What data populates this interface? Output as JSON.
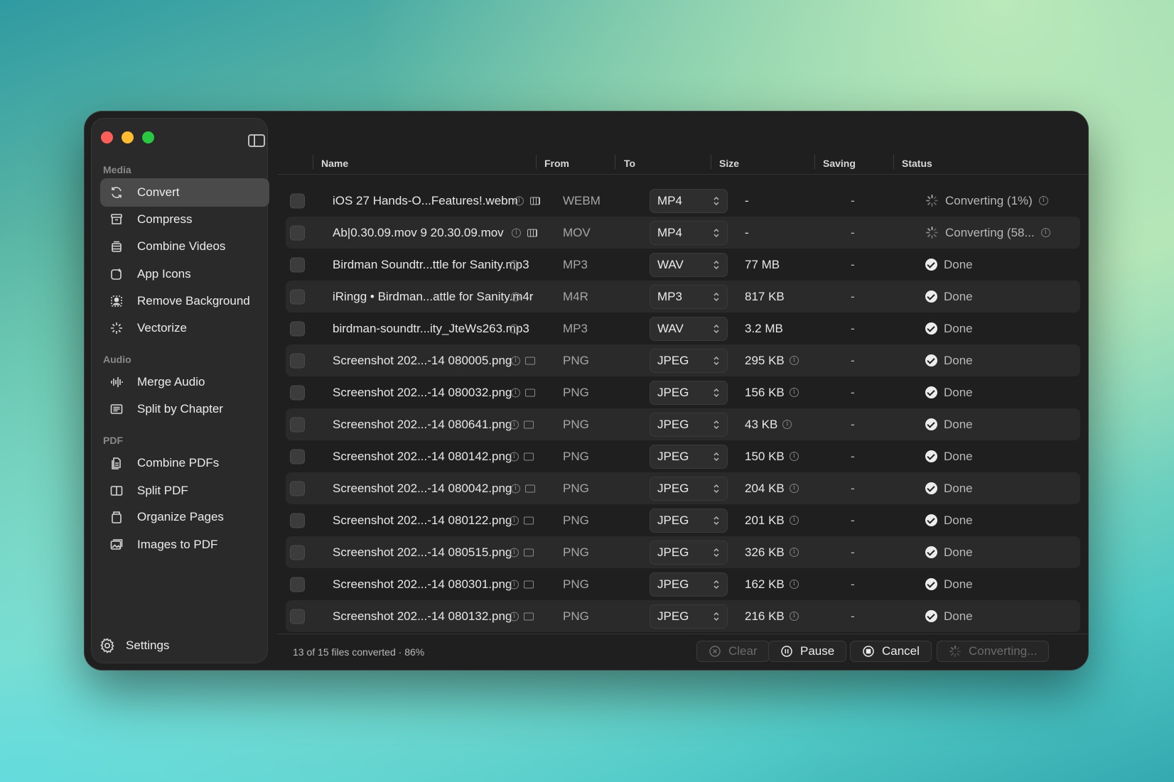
{
  "sidebar": {
    "sections": {
      "media": "Media",
      "audio": "Audio",
      "pdf": "PDF"
    },
    "media_items": [
      {
        "label": "Convert",
        "icon": "refresh-icon",
        "active": true
      },
      {
        "label": "Compress",
        "icon": "archive-icon"
      },
      {
        "label": "Combine Videos",
        "icon": "film-stack-icon"
      },
      {
        "label": "App Icons",
        "icon": "app-icon"
      },
      {
        "label": "Remove Background",
        "icon": "person-cutout-icon"
      },
      {
        "label": "Vectorize",
        "icon": "sparkle-icon"
      }
    ],
    "audio_items": [
      {
        "label": "Merge Audio",
        "icon": "waveform-icon"
      },
      {
        "label": "Split by Chapter",
        "icon": "list-icon"
      }
    ],
    "pdf_items": [
      {
        "label": "Combine PDFs",
        "icon": "documents-icon"
      },
      {
        "label": "Split PDF",
        "icon": "split-pages-icon"
      },
      {
        "label": "Organize Pages",
        "icon": "pages-icon"
      },
      {
        "label": "Images to PDF",
        "icon": "photos-icon"
      }
    ],
    "settings": "Settings"
  },
  "table": {
    "headers": {
      "name": "Name",
      "from": "From",
      "to": "To",
      "size": "Size",
      "saving": "Saving",
      "status": "Status"
    },
    "rows": [
      {
        "name": "iOS 27 Hands-O...Features!.webm",
        "preview": "film",
        "from": "WEBM",
        "to": "MP4",
        "size": "-",
        "size_info": false,
        "saving": "-",
        "status": "Converting (1%)",
        "state": "converting"
      },
      {
        "name": "Ab|0.30.09.mov  9 20.30.09.mov",
        "preview": "film",
        "from": "MOV",
        "to": "MP4",
        "size": "-",
        "size_info": false,
        "saving": "-",
        "status": "Converting (58...",
        "state": "converting"
      },
      {
        "name": "Birdman Soundtr...ttle for Sanity.mp3",
        "preview": "none",
        "from": "MP3",
        "to": "WAV",
        "size": "77 MB",
        "size_info": false,
        "saving": "-",
        "status": "Done",
        "state": "done"
      },
      {
        "name": "iRingg • Birdman...attle for Sanity.m4r",
        "preview": "none",
        "from": "M4R",
        "to": "MP3",
        "size": "817 KB",
        "size_info": false,
        "saving": "-",
        "status": "Done",
        "state": "done"
      },
      {
        "name": "birdman-soundtr...ity_JteWs263.mp3",
        "preview": "none",
        "from": "MP3",
        "to": "WAV",
        "size": "3.2 MB",
        "size_info": false,
        "saving": "-",
        "status": "Done",
        "state": "done"
      },
      {
        "name": "Screenshot 202...-14 080005.png",
        "preview": "image",
        "from": "PNG",
        "to": "JPEG",
        "size": "295 KB",
        "size_info": true,
        "saving": "-",
        "status": "Done",
        "state": "done"
      },
      {
        "name": "Screenshot 202...-14 080032.png",
        "preview": "image",
        "from": "PNG",
        "to": "JPEG",
        "size": "156 KB",
        "size_info": true,
        "saving": "-",
        "status": "Done",
        "state": "done"
      },
      {
        "name": "Screenshot 202...-14 080641.png",
        "preview": "image",
        "from": "PNG",
        "to": "JPEG",
        "size": "43 KB",
        "size_info": true,
        "saving": "-",
        "status": "Done",
        "state": "done"
      },
      {
        "name": "Screenshot 202...-14 080142.png",
        "preview": "image",
        "from": "PNG",
        "to": "JPEG",
        "size": "150 KB",
        "size_info": true,
        "saving": "-",
        "status": "Done",
        "state": "done"
      },
      {
        "name": "Screenshot 202...-14 080042.png",
        "preview": "image",
        "from": "PNG",
        "to": "JPEG",
        "size": "204 KB",
        "size_info": true,
        "saving": "-",
        "status": "Done",
        "state": "done"
      },
      {
        "name": "Screenshot 202...-14 080122.png",
        "preview": "image",
        "from": "PNG",
        "to": "JPEG",
        "size": "201 KB",
        "size_info": true,
        "saving": "-",
        "status": "Done",
        "state": "done"
      },
      {
        "name": "Screenshot 202...-14 080515.png",
        "preview": "image",
        "from": "PNG",
        "to": "JPEG",
        "size": "326 KB",
        "size_info": true,
        "saving": "-",
        "status": "Done",
        "state": "done"
      },
      {
        "name": "Screenshot 202...-14 080301.png",
        "preview": "image",
        "from": "PNG",
        "to": "JPEG",
        "size": "162 KB",
        "size_info": true,
        "saving": "-",
        "status": "Done",
        "state": "done"
      },
      {
        "name": "Screenshot 202...-14 080132.png",
        "preview": "image",
        "from": "PNG",
        "to": "JPEG",
        "size": "216 KB",
        "size_info": true,
        "saving": "-",
        "status": "Done",
        "state": "done"
      }
    ]
  },
  "footer": {
    "progress_text": "13 of 15 files converted · 86%",
    "clear_label": "Clear",
    "pause_label": "Pause",
    "cancel_label": "Cancel",
    "converting_label": "Converting..."
  },
  "colors": {
    "window_bg": "#1f1f1f",
    "sidebar_bg": "#2a2a2a",
    "active_item": "#4a4a4a",
    "close": "#ff5f57",
    "minimize": "#febc2e",
    "zoom": "#28c840"
  }
}
